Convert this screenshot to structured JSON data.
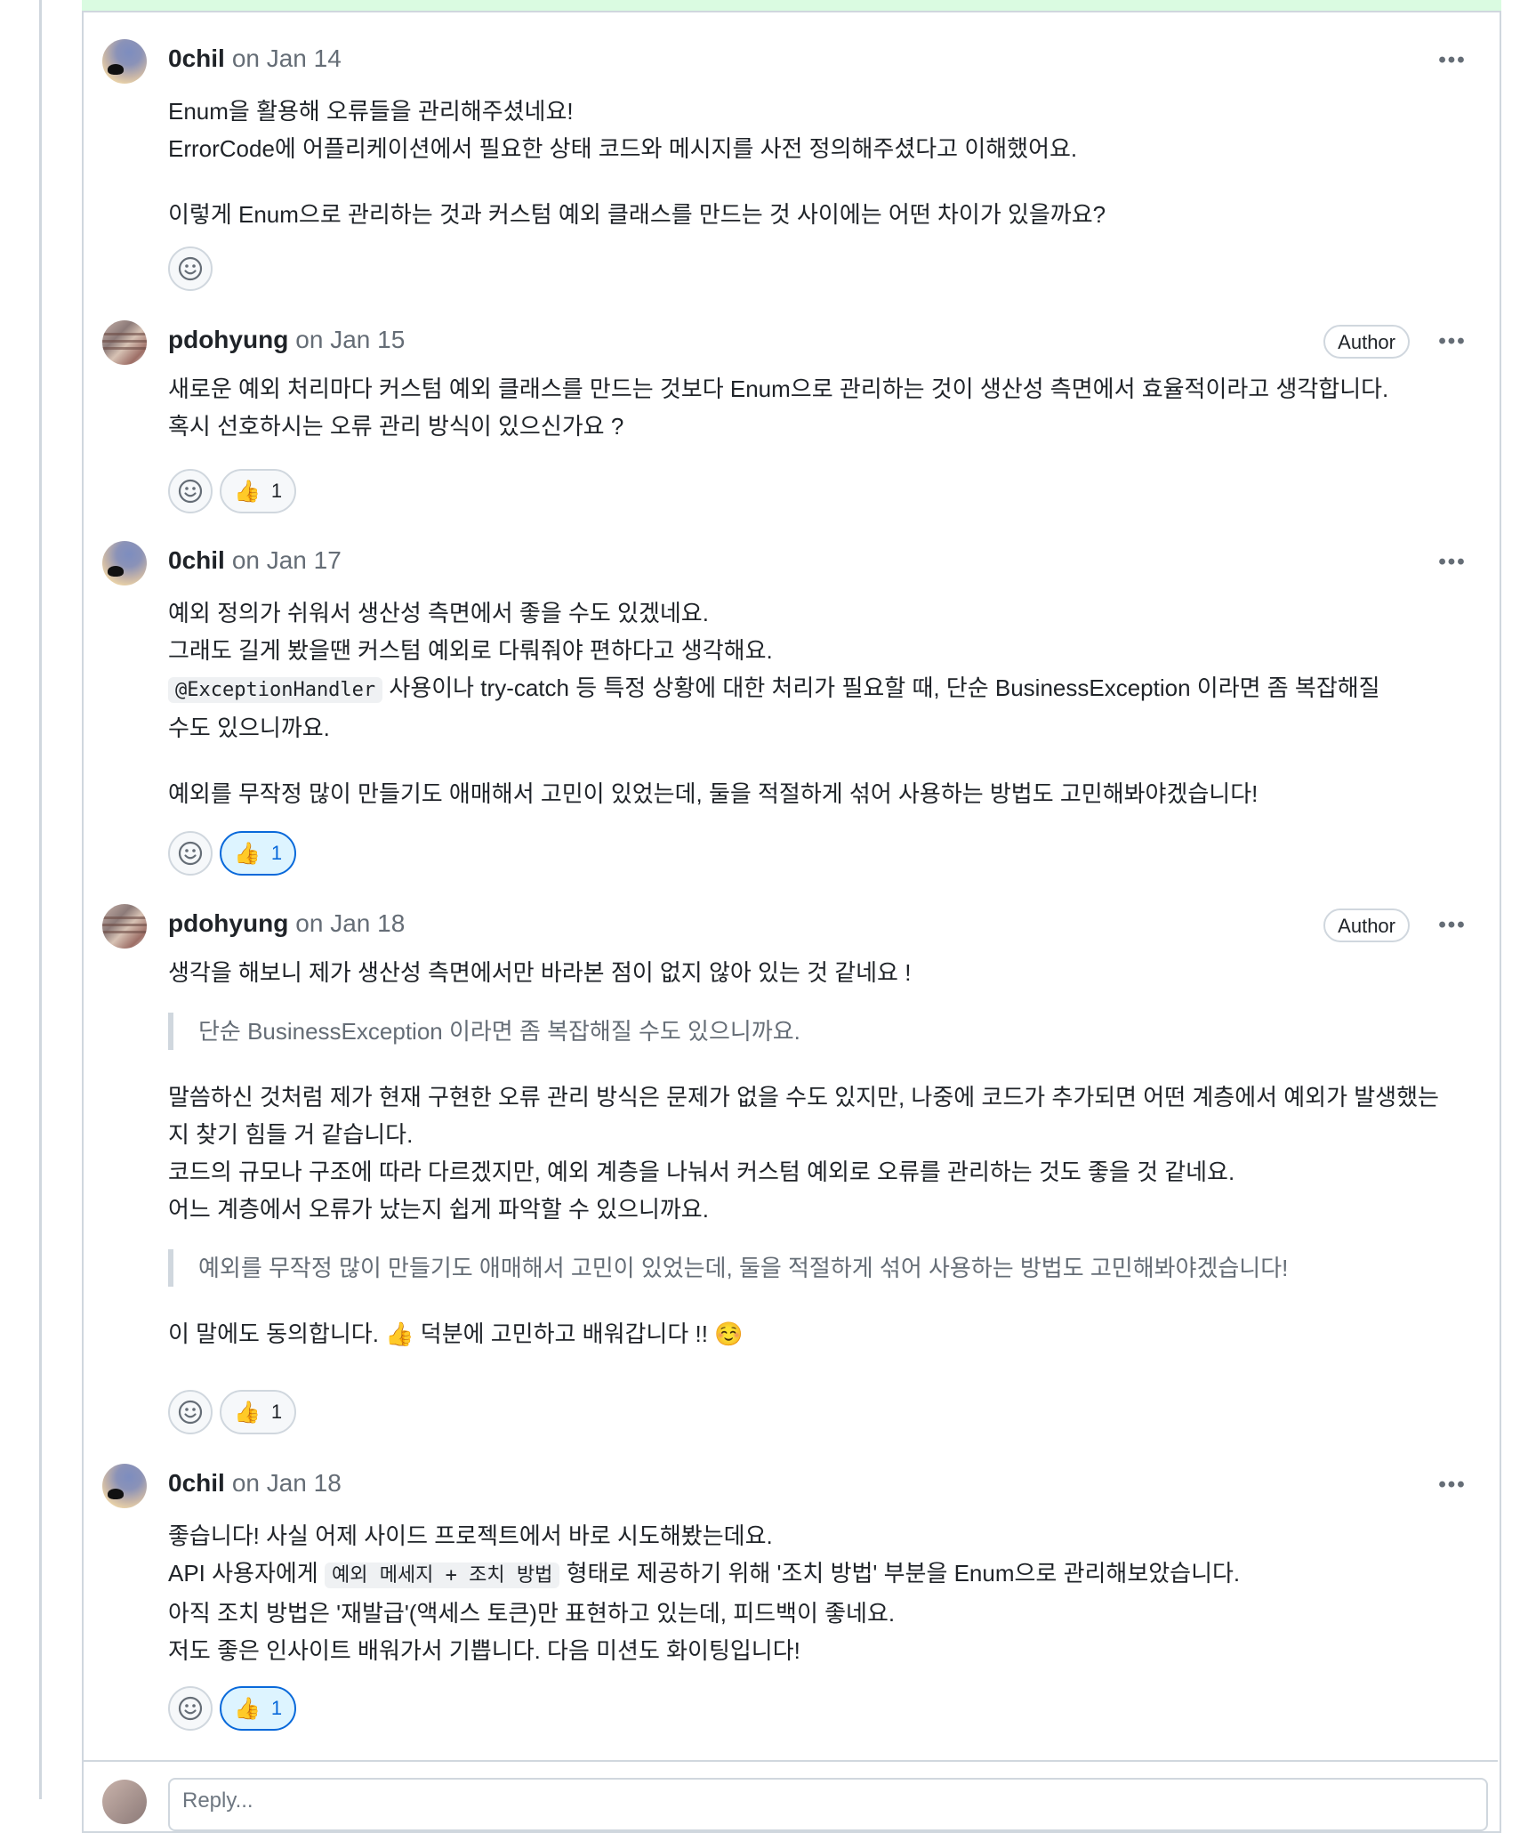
{
  "colors": {
    "link_accent": "#0969da",
    "border": "#d0d7de",
    "muted": "#656d76"
  },
  "thread_top_fragment": "",
  "comments": [
    {
      "author": "0chil",
      "date": "on Jan 14",
      "badge": "",
      "lines": [
        "Enum을 활용해 오류들을 관리해주셨네요!",
        "ErrorCode에 어플리케이션에서 필요한 상태 코드와 메시지를 사전 정의해주셨다고 이해했어요.",
        "이렇게 Enum으로 관리하는 것과 커스텀 예외 클래스를 만드는 것 사이에는 어떤 차이가 있을까요?"
      ],
      "reactions": []
    },
    {
      "author": "pdohyung",
      "date": "on Jan 15",
      "badge": "Author",
      "lines": [
        "새로운 예외 처리마다 커스텀 예외 클래스를 만드는 것보다 Enum으로 관리하는 것이 생산성 측면에서 효율적이라고 생각합니다.",
        "혹시 선호하시는 오류 관리 방식이 있으신가요 ?"
      ],
      "reactions": [
        {
          "emoji": "👍",
          "count": "1"
        }
      ]
    },
    {
      "author": "0chil",
      "date": "on Jan 17",
      "badge": "",
      "lines": [
        "예외 정의가 쉬워서 생산성 측면에서 좋을 수도 있겠네요.",
        "그래도 길게 봤을땐 커스텀 예외로 다뤄줘야 편하다고 생각해요.",
        "사용이나 try-catch 등 특정 상황에 대한 처리가 필요할 때, 단순 BusinessException 이라면 좀 복잡해질",
        "수도 있으니까요.",
        "예외를 무작정 많이 만들기도 애매해서 고민이 있었는데, 둘을 적절하게 섞어 사용하는 방법도 고민해봐야겠습니다!"
      ],
      "code": "@ExceptionHandler",
      "reactions": [
        {
          "emoji": "👍",
          "count": "1"
        }
      ]
    },
    {
      "author": "pdohyung",
      "date": "on Jan 18",
      "badge": "Author",
      "lines": [
        "생각을 해보니 제가 생산성 측면에서만 바라본 점이 없지 않아 있는 것 같네요 !",
        "말씀하신 것처럼 제가 현재 구현한 오류 관리 방식은 문제가 없을 수도 있지만, 나중에 코드가 추가되면 어떤 계층에서 예외가 발생했는",
        "지 찾기 힘들 거 같습니다.",
        "코드의 규모나 구조에 따라 다르겠지만, 예외 계층을 나눠서 커스텀 예외로 오류를 관리하는 것도 좋을 것 같네요.",
        "어느 계층에서 오류가 났는지 쉽게 파악할 수 있으니까요.",
        "이 말에도 동의합니다. 👍 덕분에 고민하고 배워갑니다 !! ☺️"
      ],
      "quotes": [
        "단순 BusinessException 이라면 좀 복잡해질 수도 있으니까요.",
        "예외를 무작정 많이 만들기도 애매해서 고민이 있었는데, 둘을 적절하게 섞어 사용하는 방법도 고민해봐야겠습니다!"
      ],
      "reactions": [
        {
          "emoji": "👍",
          "count": "1"
        }
      ]
    },
    {
      "author": "0chil",
      "date": "on Jan 18",
      "badge": "",
      "lines": [
        "좋습니다! 사실 어제 사이드 프로젝트에서 바로 시도해봤는데요.",
        "API 사용자에게",
        "형태로 제공하기 위해 '조치 방법' 부분을 Enum으로 관리해보았습니다.",
        "아직 조치 방법은 '재발급'(액세스 토큰)만 표현하고 있는데, 피드백이 좋네요.",
        "저도 좋은 인사이트 배워가서 기쁩니다. 다음 미션도 화이팅입니다!"
      ],
      "code": "예외 메세지 + 조치 방법",
      "reactions": [
        {
          "emoji": "👍",
          "count": "1"
        }
      ]
    }
  ],
  "reply": {
    "placeholder": "Reply..."
  }
}
